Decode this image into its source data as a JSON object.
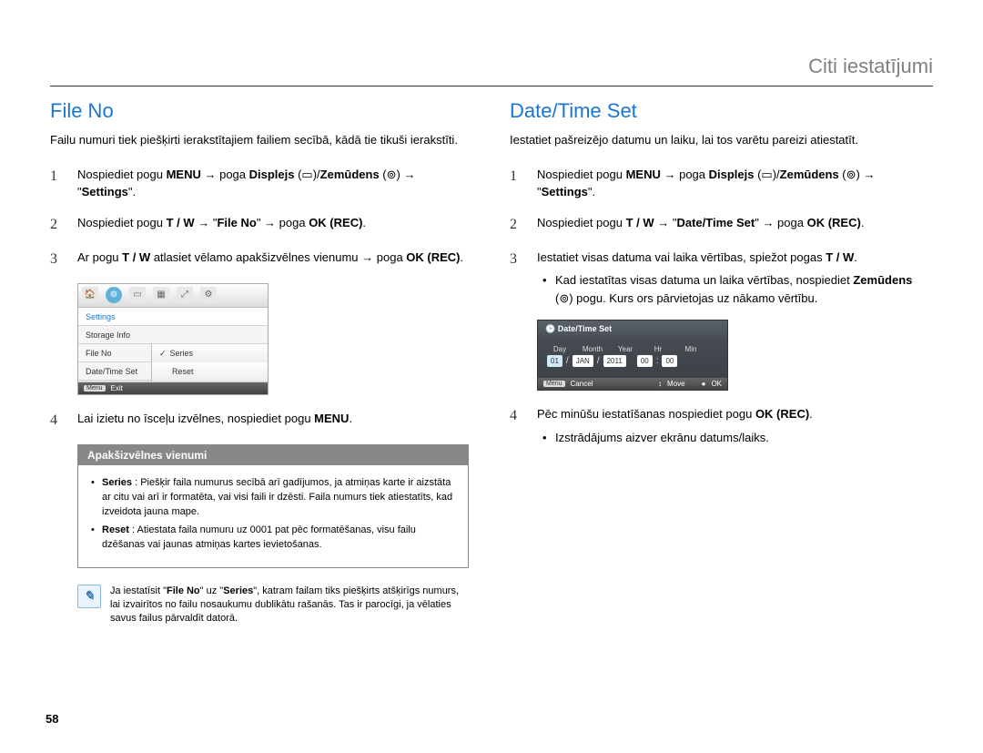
{
  "header": {
    "subtitle": "Citi iestatījumi"
  },
  "pageNumber": "58",
  "left": {
    "title": "File No",
    "intro": "Failu numuri tiek piešķirti ierakstītajiem failiem secībā, kādā tie tikuši ierakstīti.",
    "steps": {
      "n1": "1",
      "s1a": "Nospiediet pogu ",
      "s1_menu": "MENU",
      "s1b": " → poga ",
      "s1_displejs": "Displejs",
      "s1c": " (▭)/",
      "s1_zem": "Zemūdens",
      "s1d": " (⊚) → \"",
      "s1_set": "Settings",
      "s1e": "\".",
      "n2": "2",
      "s2a": "Nospiediet pogu ",
      "s2_tw": "T / W",
      "s2b": " → \"",
      "s2_fileno": "File No",
      "s2c": "\" → poga ",
      "s2_ok": "OK (REC)",
      "s2d": ".",
      "n3": "3",
      "s3a": "Ar pogu ",
      "s3_tw": "T / W",
      "s3b": " atlasiet vēlamo apakšizvēlnes vienumu → poga ",
      "s3_ok": "OK (REC)",
      "s3c": ".",
      "n4": "4",
      "s4a": "Lai izietu no īsceļu izvēlnes, nospiediet pogu ",
      "s4_menu": "MENU",
      "s4b": "."
    },
    "screenshot": {
      "row_settings": "Settings",
      "row_storage": "Storage Info",
      "row_fileno": "File No",
      "row_datetime": "Date/Time Set",
      "opt_series": "Series",
      "opt_reset": "Reset",
      "foot_exit": "Exit",
      "foot_menu": "Menu"
    },
    "submenu_title": "Apakšizvēlnes vienumi",
    "series_label": "Series",
    "series_desc": " : Piešķir faila numurus secībā arī gadījumos, ja atmiņas karte ir aizstāta ar citu vai arī ir formatēta, vai visi faili ir dzēsti. Faila numurs tiek atiestatīts, kad izveidota jauna mape.",
    "reset_label": "Reset",
    "reset_desc": " : Atiestata faila numuru uz 0001 pat pēc formatēšanas, visu failu dzēšanas vai jaunas atmiņas kartes ievietošanas.",
    "note_a": "Ja iestatīsit \"",
    "note_fileno": "File No",
    "note_b": "\" uz \"",
    "note_series": "Series",
    "note_c": "\", katram failam tiks piešķirts atšķirīgs numurs, lai izvairītos no failu nosaukumu dublikātu rašanās. Tas ir parocīgi, ja vēlaties savus failus pārvaldīt datorā."
  },
  "right": {
    "title": "Date/Time Set",
    "intro": "Iestatiet pašreizējo datumu un laiku, lai tos varētu pareizi atiestatīt.",
    "steps": {
      "n1": "1",
      "s1a": "Nospiediet pogu ",
      "s1_menu": "MENU",
      "s1b": " → poga ",
      "s1_displejs": "Displejs",
      "s1c": " (▭)/",
      "s1_zem": "Zemūdens",
      "s1d": " (⊚) → \"",
      "s1_set": "Settings",
      "s1e": "\".",
      "n2": "2",
      "s2a": "Nospiediet pogu ",
      "s2_tw": "T / W",
      "s2b": " → \"",
      "s2_dt": "Date/Time Set",
      "s2c": "\" → poga ",
      "s2_ok": "OK (REC)",
      "s2d": ".",
      "n3": "3",
      "s3a": "Iestatiet visas datuma vai laika vērtības, spiežot pogas ",
      "s3_tw": "T / W",
      "s3b": ".",
      "s3_sub_a": "Kad iestatītas visas datuma un laika vērtības, nospiediet ",
      "s3_sub_bold": "Zemūdens",
      "s3_sub_b": " (⊚) pogu. Kurs ors pārvietojas uz nākamo vērtību.",
      "n4": "4",
      "s4a": "Pēc minūšu iestatīšanas nospiediet pogu ",
      "s4_ok": "OK (REC)",
      "s4b": ".",
      "s4_sub": "Izstrādājums aizver ekrānu datums/laiks."
    },
    "screenshot": {
      "title": "Date/Time Set",
      "lbl_day": "Day",
      "lbl_month": "Month",
      "lbl_year": "Year",
      "lbl_hr": "Hr",
      "lbl_min": "Min",
      "val_day": "01",
      "val_month": "JAN",
      "val_year": "2011",
      "val_hr": "00",
      "val_min": "00",
      "foot_cancel": "Cancel",
      "foot_move": "Move",
      "foot_ok": "OK",
      "foot_menu": "Menu"
    }
  }
}
